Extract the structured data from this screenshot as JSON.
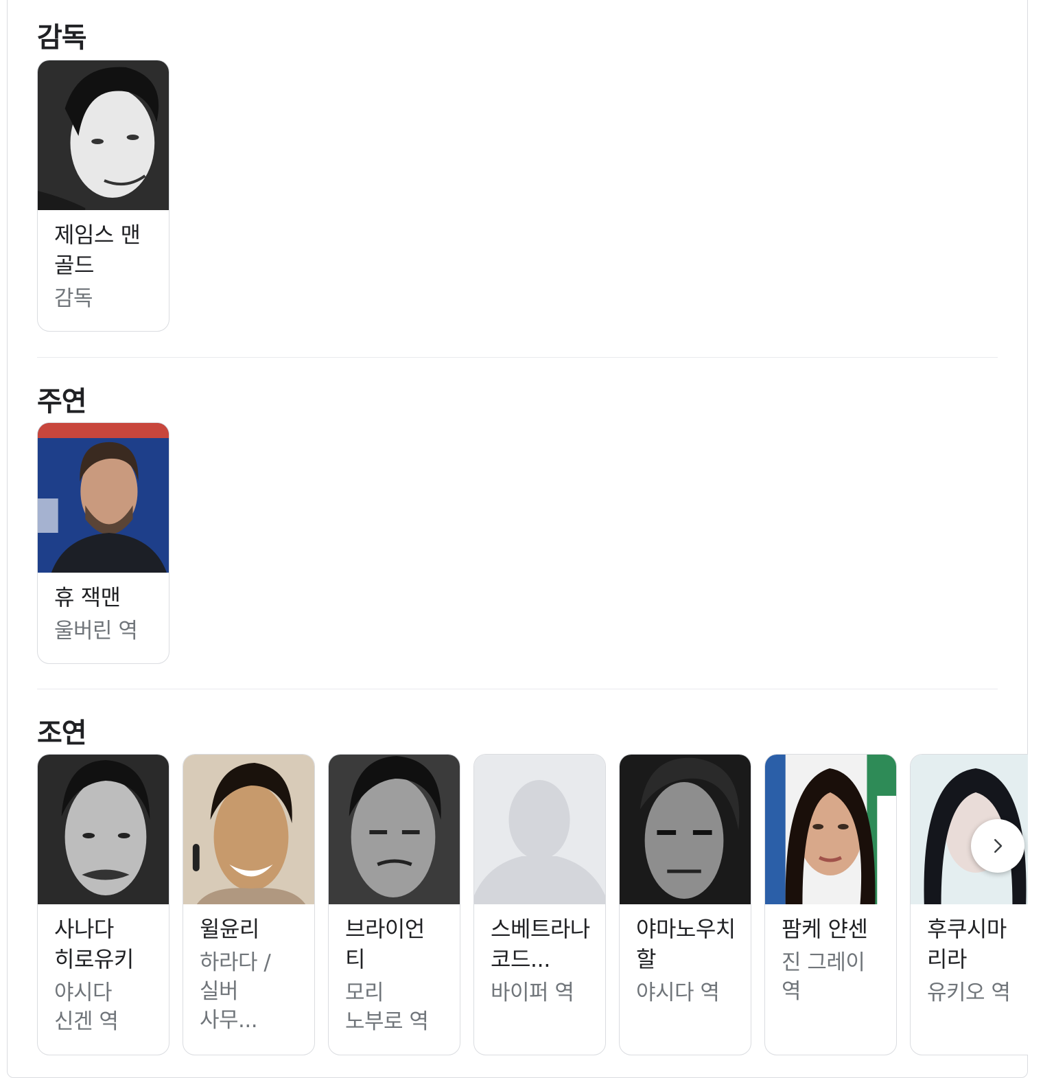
{
  "sections": {
    "director": {
      "title": "감독",
      "cards": [
        {
          "name": "제임스 맨 골드",
          "role": "감독",
          "photo": "director-portrait"
        }
      ]
    },
    "main_cast": {
      "title": "주연",
      "cards": [
        {
          "name": "휴 잭맨",
          "role": "울버린 역",
          "photo": "actor-portrait"
        }
      ]
    },
    "supporting_cast": {
      "title": "조연",
      "cards": [
        {
          "name": "사나다 히로유키",
          "role": "야시다 신겐 역",
          "photo": "actor-portrait"
        },
        {
          "name": "윌윤리",
          "role": "하라다 /실버 사무...",
          "photo": "actor-portrait"
        },
        {
          "name": "브라이언 티",
          "role": "모리 노부로 역",
          "photo": "actor-portrait"
        },
        {
          "name": "스베트라나 코드...",
          "role": "바이퍼 역",
          "photo": "placeholder-person-icon"
        },
        {
          "name": "야마노우치 할",
          "role": "야시다 역",
          "photo": "actor-portrait"
        },
        {
          "name": "팜케 얀센",
          "role": "진 그레이 역",
          "photo": "actor-portrait"
        },
        {
          "name": "후쿠시마 리라",
          "role": "유키오 역",
          "photo": "actor-portrait"
        }
      ]
    }
  },
  "carousel": {
    "next_icon": "chevron-right-icon"
  }
}
